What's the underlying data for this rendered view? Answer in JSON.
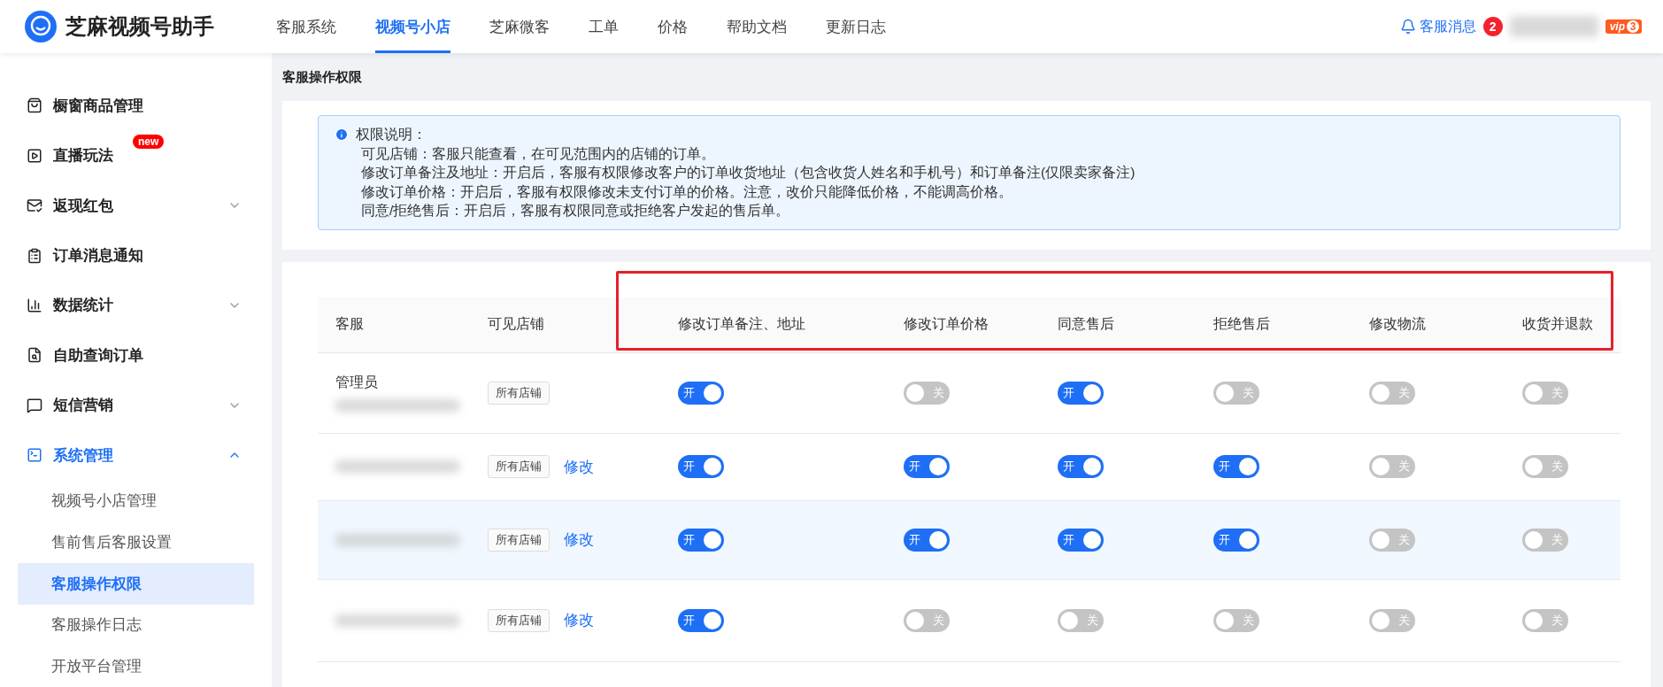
{
  "header": {
    "logo_text": "芝麻视频号助手",
    "nav": [
      {
        "label": "客服系统",
        "selected": false
      },
      {
        "label": "视频号小店",
        "selected": true
      },
      {
        "label": "芝麻微客",
        "selected": false
      },
      {
        "label": "工单",
        "selected": false
      },
      {
        "label": "价格",
        "selected": false
      },
      {
        "label": "帮助文档",
        "selected": false
      },
      {
        "label": "更新日志",
        "selected": false
      }
    ],
    "messages": {
      "label": "客服消息",
      "count": "2"
    },
    "vip": {
      "label": "vip",
      "level": "3"
    }
  },
  "sidebar": {
    "items": [
      {
        "label": "橱窗商品管理",
        "active": false
      },
      {
        "label": "直播玩法",
        "active": false,
        "badge": "new"
      },
      {
        "label": "返现红包",
        "active": false,
        "expanded": false
      },
      {
        "label": "订单消息通知",
        "active": false
      },
      {
        "label": "数据统计",
        "active": false,
        "expanded": false
      },
      {
        "label": "自助查询订单",
        "active": false
      },
      {
        "label": "短信营销",
        "active": false,
        "expanded": false
      },
      {
        "label": "系统管理",
        "active": true,
        "expanded": true,
        "children": [
          {
            "label": "视频号小店管理",
            "selected": false
          },
          {
            "label": "售前售后客服设置",
            "selected": false
          },
          {
            "label": "客服操作权限",
            "selected": true
          },
          {
            "label": "客服操作日志",
            "selected": false
          },
          {
            "label": "开放平台管理",
            "selected": false
          }
        ]
      }
    ]
  },
  "page_title": "客服操作权限",
  "notice": {
    "title": "权限说明：",
    "lines": [
      "可见店铺：客服只能查看，在可见范围内的店铺的订单。",
      "修改订单备注及地址：开启后，客服有权限修改客户的订单收货地址（包含收货人姓名和手机号）和订单备注(仅限卖家备注)",
      "修改订单价格：开启后，客服有权限修改未支付订单的价格。注意，改价只能降低价格，不能调高价格。",
      "同意/拒绝售后：开启后，客服有权限同意或拒绝客户发起的售后单。"
    ]
  },
  "table": {
    "columns": [
      "客服",
      "可见店铺",
      "修改订单备注、地址",
      "修改订单价格",
      "同意售后",
      "拒绝售后",
      "修改物流",
      "收货并退款"
    ],
    "annotation": {
      "kind": "frame"
    },
    "rows": [
      {
        "name": "管理员",
        "highlighted": false,
        "shop": "所有店铺",
        "toggles": [
          {
            "on": true,
            "label": "开"
          },
          {
            "on": false,
            "label": "关"
          },
          {
            "on": true,
            "label": "开"
          },
          {
            "on": false,
            "label": "关"
          },
          {
            "on": false,
            "label": "关"
          },
          {
            "on": false,
            "label": "关"
          }
        ]
      },
      {
        "highlighted": false,
        "shop": "所有店铺",
        "edit": "修改",
        "toggles": [
          {
            "on": true,
            "label": "开"
          },
          {
            "on": true,
            "label": "开"
          },
          {
            "on": true,
            "label": "开"
          },
          {
            "on": true,
            "label": "开"
          },
          {
            "on": false,
            "label": "关"
          },
          {
            "on": false,
            "label": "关"
          }
        ]
      },
      {
        "highlighted": true,
        "shop": "所有店铺",
        "edit": "修改",
        "toggles": [
          {
            "on": true,
            "label": "开"
          },
          {
            "on": true,
            "label": "开"
          },
          {
            "on": true,
            "label": "开"
          },
          {
            "on": true,
            "label": "开"
          },
          {
            "on": false,
            "label": "关"
          },
          {
            "on": false,
            "label": "关"
          }
        ]
      },
      {
        "highlighted": false,
        "shop": "所有店铺",
        "edit": "修改",
        "toggles": [
          {
            "on": true,
            "label": "开"
          },
          {
            "on": false,
            "label": "关"
          },
          {
            "on": false,
            "label": "关"
          },
          {
            "on": false,
            "label": "关"
          },
          {
            "on": false,
            "label": "关"
          },
          {
            "on": false,
            "label": "关"
          }
        ]
      }
    ]
  }
}
